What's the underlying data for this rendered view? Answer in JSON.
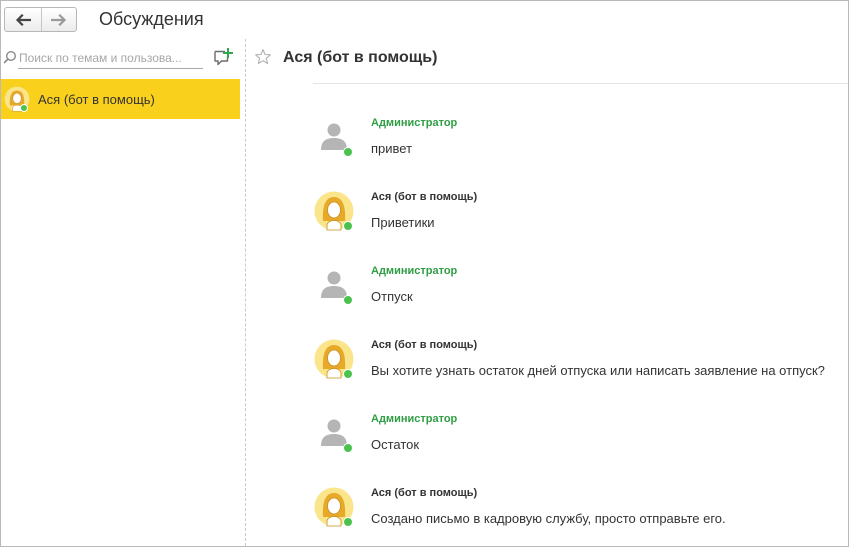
{
  "window": {
    "title": "Обсуждения"
  },
  "nav": {
    "back_icon": "arrow-left-icon",
    "forward_icon": "arrow-right-icon"
  },
  "sidebar": {
    "search_placeholder": "Поиск по темам и пользова...",
    "search_value": "",
    "new_discussion_icon": "new-chat-plus-icon",
    "conversations": [
      {
        "label": "Ася (бот в помощь)",
        "selected": true,
        "presence": "online"
      }
    ]
  },
  "chat": {
    "title": "Ася (бот в помощь)",
    "favorite_icon": "star-outline-icon",
    "messages": [
      {
        "author": "Администратор",
        "role": "admin",
        "avatar": "user-silhouette-icon",
        "presence": "online",
        "text": "привет"
      },
      {
        "author": "Ася (бот в помощь)",
        "role": "bot",
        "avatar": "bot-girl-avatar",
        "presence": "online",
        "text": "Приветики"
      },
      {
        "author": "Администратор",
        "role": "admin",
        "avatar": "user-silhouette-icon",
        "presence": "online",
        "text": "Отпуск"
      },
      {
        "author": "Ася (бот в помощь)",
        "role": "bot",
        "avatar": "bot-girl-avatar",
        "presence": "online",
        "text": "Вы хотите узнать остаток дней отпуска или написать заявление на отпуск?"
      },
      {
        "author": "Администратор",
        "role": "admin",
        "avatar": "user-silhouette-icon",
        "presence": "online",
        "text": "Остаток"
      },
      {
        "author": "Ася (бот в помощь)",
        "role": "bot",
        "avatar": "bot-girl-avatar",
        "presence": "online",
        "text": "Создано письмо в кадровую службу, просто отправьте его."
      }
    ]
  },
  "colors": {
    "selected_conversation": "#f9d01c",
    "admin_author": "#2f9e44",
    "presence_online": "#4bc24e",
    "avatar_bg": "#fbe58a"
  }
}
